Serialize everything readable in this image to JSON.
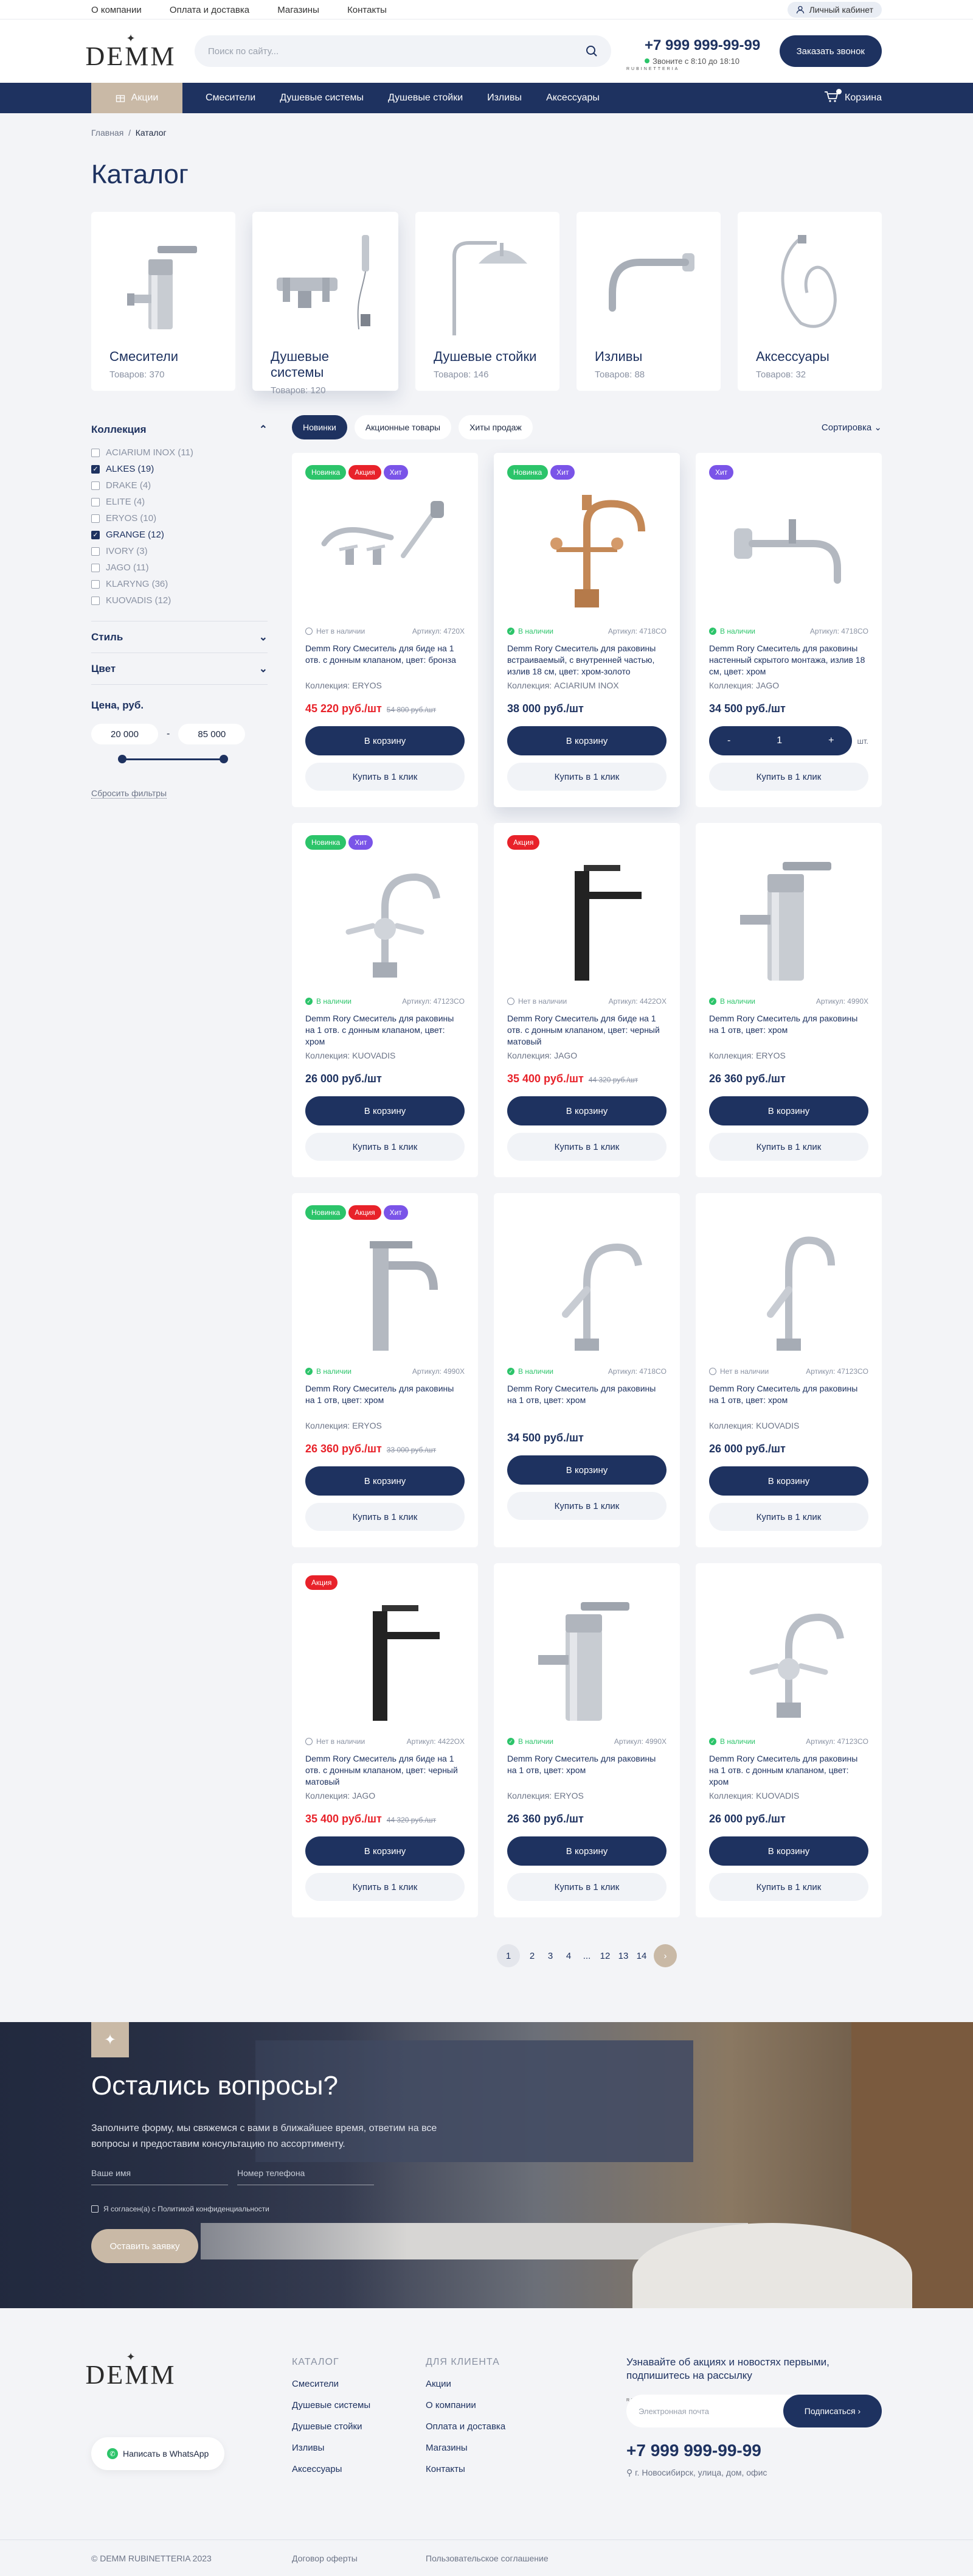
{
  "topbar": {
    "links": [
      "О компании",
      "Оплата и доставка",
      "Магазины",
      "Контакты"
    ],
    "account": "Личный кабинет"
  },
  "header": {
    "logo": {
      "name": "DEMM",
      "sub": "RUBINETTERIA"
    },
    "search_placeholder": "Поиск по сайту...",
    "phone": "+7 999 999-99-99",
    "hours": "Звоните с 8:10 до 18:10",
    "call_button": "Заказать звонок"
  },
  "nav": {
    "promo": "Акции",
    "items": [
      "Смесители",
      "Душевые системы",
      "Душевые стойки",
      "Изливы",
      "Аксессуары"
    ],
    "cart": "Корзина"
  },
  "breadcrumb": {
    "home": "Главная",
    "sep": "/",
    "current": "Каталог"
  },
  "page_title": "Каталог",
  "categories": [
    {
      "title": "Смесители",
      "count": "Товаров: 370"
    },
    {
      "title": "Душевые системы",
      "count": "Товаров: 120"
    },
    {
      "title": "Душевые стойки",
      "count": "Товаров: 146"
    },
    {
      "title": "Изливы",
      "count": "Товаров: 88"
    },
    {
      "title": "Аксессуары",
      "count": "Товаров: 32"
    }
  ],
  "filters": {
    "collection_title": "Коллекция",
    "collections": [
      {
        "label": "ACIARIUM INOX (11)",
        "checked": false
      },
      {
        "label": "ALKES (19)",
        "checked": true
      },
      {
        "label": "DRAKE (4)",
        "checked": false
      },
      {
        "label": "ELITE (4)",
        "checked": false
      },
      {
        "label": "ERYOS (10)",
        "checked": false
      },
      {
        "label": "GRANGE (12)",
        "checked": true
      },
      {
        "label": "IVORY (3)",
        "checked": false
      },
      {
        "label": "JAGO (11)",
        "checked": false
      },
      {
        "label": "KLARYNG (36)",
        "checked": false
      },
      {
        "label": "KUOVADIS (12)",
        "checked": false
      }
    ],
    "style_title": "Стиль",
    "color_title": "Цвет",
    "price_title": "Цена, руб.",
    "price_from": "20 000",
    "price_dash": "-",
    "price_to": "85 000",
    "reset": "Сбросить фильтры"
  },
  "tabs": [
    "Новинки",
    "Акционные товары",
    "Хиты продаж"
  ],
  "sort": "Сортировка",
  "tag_labels": {
    "new": "Новинка",
    "sale": "Акция",
    "hit": "Хит"
  },
  "buttons": {
    "cart": "В корзину",
    "one_click": "Купить в 1 клик",
    "qty_minus": "-",
    "qty_value": "1",
    "qty_plus": "+",
    "unit": "шт."
  },
  "products": [
    {
      "tags": [
        "new",
        "sale",
        "hit"
      ],
      "stock": "Нет в наличии",
      "in": false,
      "sku": "Артикул: 4720X",
      "name": "Demm Rory Смеситель для биде на 1 отв. с донным клапаном, цвет: бронза",
      "coll": "Коллекция: ERYOS",
      "price": "45 220 руб./шт",
      "old": "54 800 руб./шт",
      "sale": true
    },
    {
      "tags": [
        "new",
        "hit"
      ],
      "stock": "В наличии",
      "in": true,
      "sku": "Артикул: 4718CO",
      "name": "Demm Rory Смеситель для раковины встраиваемый, с внутренней частью, излив 18 см, цвет: хром-золото",
      "coll": "Коллекция: ACIARIUM INOX",
      "price": "38 000 руб./шт",
      "old": "",
      "sale": false
    },
    {
      "tags": [
        "hit"
      ],
      "stock": "В наличии",
      "in": true,
      "sku": "Артикул: 4718CO",
      "name": "Demm Rory Смеситель для раковины настенный скрытого монтажа, излив 18 см, цвет: хром",
      "coll": "Коллекция: JAGO",
      "price": "34 500 руб./шт",
      "old": "",
      "sale": false,
      "qty": true
    },
    {
      "tags": [
        "new",
        "hit"
      ],
      "stock": "В наличии",
      "in": true,
      "sku": "Артикул: 47123CO",
      "name": "Demm Rory Смеситель для раковины на 1 отв. с донным клапаном, цвет: хром",
      "coll": "Коллекция: KUOVADIS",
      "price": "26 000 руб./шт",
      "old": "",
      "sale": false
    },
    {
      "tags": [
        "sale"
      ],
      "stock": "Нет в наличии",
      "in": false,
      "sku": "Артикул: 4422OX",
      "name": "Demm Rory Смеситель для биде на 1 отв. с донным клапаном, цвет: черный матовый",
      "coll": "Коллекция: JAGO",
      "price": "35 400 руб./шт",
      "old": "44 320 руб./шт",
      "sale": true
    },
    {
      "tags": [],
      "stock": "В наличии",
      "in": true,
      "sku": "Артикул: 4990X",
      "name": "Demm Rory Смеситель для раковины на 1 отв, цвет: хром",
      "coll": "Коллекция: ERYOS",
      "price": "26 360 руб./шт",
      "old": "",
      "sale": false
    },
    {
      "tags": [
        "new",
        "sale",
        "hit"
      ],
      "stock": "В наличии",
      "in": true,
      "sku": "Артикул: 4990X",
      "name": "Demm Rory Смеситель для раковины на 1 отв, цвет: хром",
      "coll": "Коллекция: ERYOS",
      "price": "26 360 руб./шт",
      "old": "33 000 руб./шт",
      "sale": true
    },
    {
      "tags": [],
      "stock": "В наличии",
      "in": true,
      "sku": "Артикул: 4718CO",
      "name": "Demm Rory Смеситель для раковины на 1 отв, цвет: хром",
      "coll": "",
      "price": "34 500 руб./шт",
      "old": "",
      "sale": false
    },
    {
      "tags": [],
      "stock": "Нет в наличии",
      "in": false,
      "sku": "Артикул: 47123CO",
      "name": "Demm Rory Смеситель для раковины на 1 отв, цвет: хром",
      "coll": "Коллекция: KUOVADIS",
      "price": "26 000 руб./шт",
      "old": "",
      "sale": false
    },
    {
      "tags": [
        "sale"
      ],
      "stock": "Нет в наличии",
      "in": false,
      "sku": "Артикул: 4422OX",
      "name": "Demm Rory Смеситель для биде на 1 отв. с донным клапаном, цвет: черный матовый",
      "coll": "Коллекция: JAGO",
      "price": "35 400 руб./шт",
      "old": "44 320 руб./шт",
      "sale": true
    },
    {
      "tags": [],
      "stock": "В наличии",
      "in": true,
      "sku": "Артикул: 4990X",
      "name": "Demm Rory Смеситель для раковины на 1 отв, цвет: хром",
      "coll": "Коллекция: ERYOS",
      "price": "26 360 руб./шт",
      "old": "",
      "sale": false
    },
    {
      "tags": [],
      "stock": "В наличии",
      "in": true,
      "sku": "Артикул: 47123CO",
      "name": "Demm Rory Смеситель для раковины на 1 отв. с донным клапаном, цвет: хром",
      "coll": "Коллекция: KUOVADIS",
      "price": "26 000 руб./шт",
      "old": "",
      "sale": false
    }
  ],
  "pagination": [
    "1",
    "2",
    "3",
    "4",
    "...",
    "12",
    "13",
    "14"
  ],
  "questions": {
    "title": "Остались вопросы?",
    "text": "Заполните форму, мы свяжемся с вами в ближайшее время, ответим на все вопросы и предоставим консультацию по ассортименту.",
    "name_placeholder": "Ваше имя",
    "phone_placeholder": "Номер телефона",
    "agree": "Я согласен(а) с Политикой конфиденциальности",
    "submit": "Оставить заявку"
  },
  "footer": {
    "whatsapp": "Написать в WhatsApp",
    "catalog_title": "КАТАЛОГ",
    "catalog": [
      "Смесители",
      "Душевые системы",
      "Душевые стойки",
      "Изливы",
      "Аксессуары"
    ],
    "client_title": "ДЛЯ КЛИЕНТА",
    "client": [
      "Акции",
      "О компании",
      "Оплата и доставка",
      "Магазины",
      "Контакты"
    ],
    "subscribe_title": "Узнавайте об акциях и новостях первыми, подпишитесь на рассылку",
    "email_placeholder": "Электронная почта",
    "subscribe_button": "Подписаться",
    "phone": "+7 999 999-99-99",
    "address": "г. Новосибирск, улица, дом, офис",
    "copyright": "© DEMM RUBINETTERIA 2023",
    "offer": "Договор оферты",
    "agreement": "Пользовательское соглашение"
  },
  "colors": {
    "primary": "#1e3260",
    "accent": "#c9b9a6",
    "new": "#2cc46a",
    "sale": "#e8222a",
    "hit": "#7a54e8"
  }
}
